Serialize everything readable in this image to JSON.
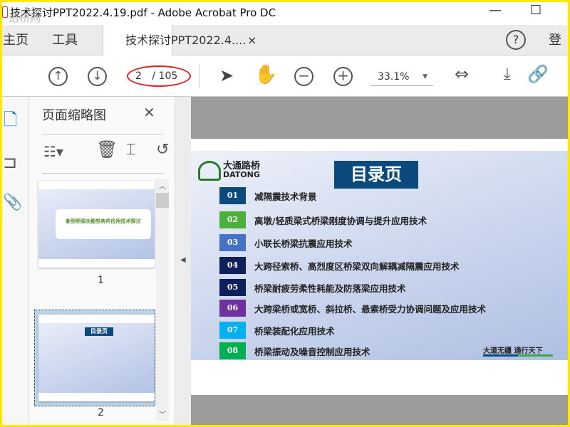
{
  "window": {
    "title": "技术探讨PPT2022.4.19.pdf - Adobe Acrobat Pro DC",
    "watermark": "逍桥网",
    "minimize": "—",
    "maximize": "☐"
  },
  "tabs": [
    {
      "label": "主页"
    },
    {
      "label": "工具"
    },
    {
      "label": "技术探讨PPT2022.4....",
      "close": "×",
      "active": true
    }
  ],
  "header": {
    "help": "?",
    "signin": "登录"
  },
  "toolbar": {
    "page_current": "2",
    "page_total": "/ 105",
    "zoom": "33.1%",
    "zoom_caret": "▼"
  },
  "panel": {
    "title": "页面缩略图",
    "close": "✕",
    "thumbnails": [
      {
        "page": "1",
        "title": "新型桥梁功能性构件应用技术探讨"
      },
      {
        "page": "2",
        "title": "目录页"
      }
    ]
  },
  "slide": {
    "logo_cn": "大通路桥",
    "logo_en": "DATONG",
    "title": "目录页",
    "slogan": "大道无疆 通行天下",
    "items": [
      {
        "num": "01",
        "label": "减隔震技术背景",
        "color": "#0b4a7c"
      },
      {
        "num": "02",
        "label": "高墩/轻质梁式桥梁刚度协调与提升应用技术",
        "color": "#4caf3a"
      },
      {
        "num": "03",
        "label": "小联长桥梁抗震应用技术",
        "color": "#4472c4"
      },
      {
        "num": "04",
        "label": "大跨径索桥、高烈度区桥梁双向解耦减隔震应用技术",
        "color": "#0e1f5b"
      },
      {
        "num": "05",
        "label": "桥梁耐疲劳柔性耗能及防落梁应用技术",
        "color": "#0e1f5b"
      },
      {
        "num": "06",
        "label": "大跨梁桥或宽桥、斜拉桥、悬索桥受力协调问题及应用技术",
        "color": "#7030a0"
      },
      {
        "num": "07",
        "label": "桥梁装配化应用技术",
        "color": "#00b0f0"
      },
      {
        "num": "08",
        "label": "桥梁振动及噪音控制应用技术",
        "color": "#00b050"
      }
    ]
  }
}
